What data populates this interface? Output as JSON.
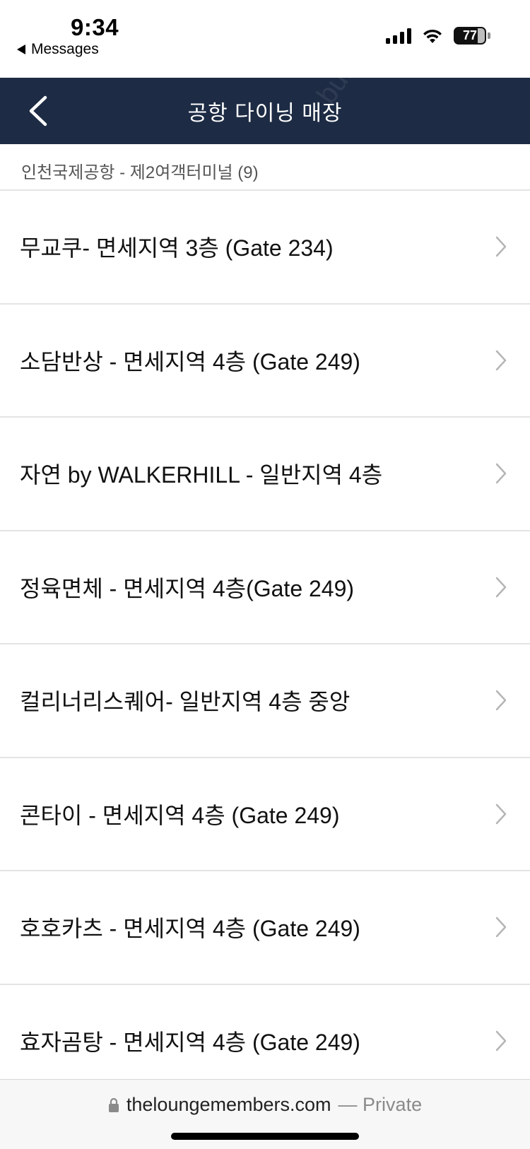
{
  "status_bar": {
    "time": "9:34",
    "back_app": "Messages",
    "battery_level": "77",
    "icons": [
      "cellular-signal-icon",
      "wifi-icon",
      "battery-icon"
    ]
  },
  "header": {
    "title": "공항 다이닝 매장",
    "back_icon": "chevron-left-icon",
    "watermark": "bunggona"
  },
  "section": {
    "heading": "인천국제공항 - 제2여객터미널 (9)"
  },
  "list": {
    "items": [
      {
        "label": "무교쿠- 면세지역 3층 (Gate 234)"
      },
      {
        "label": "소담반상 - 면세지역 4층 (Gate 249)"
      },
      {
        "label": "자연 by WALKERHILL - 일반지역 4층"
      },
      {
        "label": "정육면체 - 면세지역 4층(Gate 249)"
      },
      {
        "label": "컬리너리스퀘어- 일반지역 4층 중앙"
      },
      {
        "label": "콘타이 - 면세지역 4층 (Gate 249)"
      },
      {
        "label": "호호카츠 - 면세지역 4층 (Gate 249)"
      },
      {
        "label": "효자곰탕 - 면세지역 4층 (Gate 249)"
      }
    ]
  },
  "browser": {
    "domain": "theloungemembers.com",
    "privacy": "— Private"
  },
  "colors": {
    "header_bg": "#1d2b44",
    "divider": "#e4e4e4",
    "chevron": "#b5b5b5"
  }
}
